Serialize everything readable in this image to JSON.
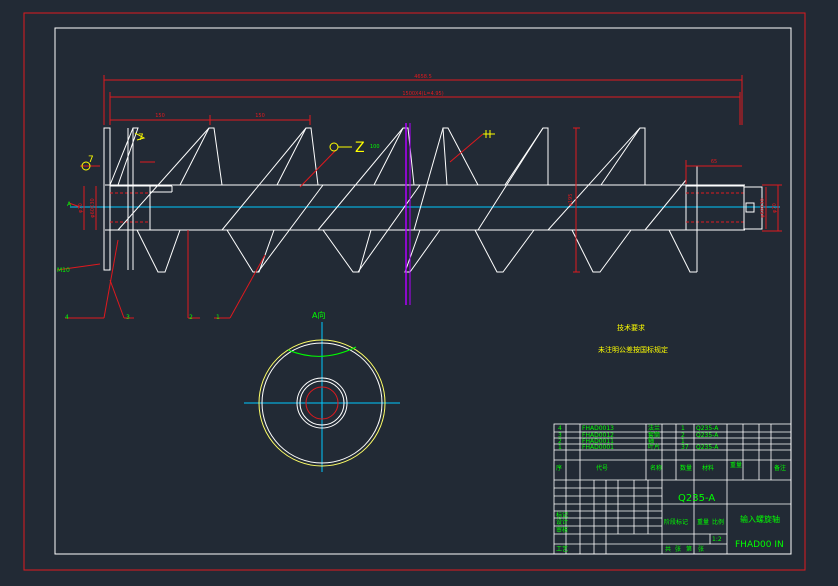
{
  "colors": {
    "background": "#222a35",
    "frame_outer": "#e0191e",
    "frame_inner": "#ffffff",
    "dimension": "#e0191e",
    "annotation": "#00ff00",
    "center_line": "#00c8ff",
    "cut_line": "#b000ff",
    "section_curve": "#ffff66",
    "text_yellow": "#ffff00"
  },
  "dimensions": {
    "overall_length": "4658.5",
    "spiral_length": "1500X4(L=4.95)",
    "pitch_a": "150",
    "pitch_b": "150",
    "end_length": "65",
    "outer_diameter": "φ195",
    "shaft_left": "φ70",
    "shaft_left_bore": "φ60X30",
    "shaft_center": "φ68",
    "shaft_right": "φ70",
    "shaft_right_bore": "φ60X30"
  },
  "callouts": {
    "section_mark": "A",
    "section_view_label": "A向",
    "part_1": "1",
    "part_2": "2",
    "part_3": "3",
    "part_4": "4",
    "weld_left_top": "7",
    "weld_left_mid": "7",
    "weld_left_bottom": "M10",
    "weld_symbol": "Z",
    "weld_note": "100",
    "spacer_note": "5"
  },
  "notes": {
    "title": "技术要求",
    "line1": "未注明公差按国标规定"
  },
  "title_block": {
    "material": "Q235-A",
    "drawing_name": "输入螺旋轴",
    "drawing_code": "FHAD00 IN",
    "scale": "1:2",
    "bom_rows": [
      {
        "no": "4",
        "code": "FHAD0013",
        "name": "法兰",
        "qty": "1",
        "mat": "Q235-A"
      },
      {
        "no": "3",
        "code": "FHAD0012",
        "name": "套筒",
        "qty": "2",
        "mat": "Q235-A"
      },
      {
        "no": "2",
        "code": "FHAD0011",
        "name": "轴",
        "qty": "1",
        "mat": ""
      },
      {
        "no": "1",
        "code": "FHAD0001",
        "name": "叶片",
        "qty": "37",
        "mat": "Q235-A"
      }
    ],
    "header": {
      "no": "序",
      "code": "代号",
      "name": "名称",
      "qty": "数量",
      "mat": "材料",
      "remark": "备注",
      "weight": "重量"
    },
    "left_labels": [
      "标记",
      "设计",
      "审核",
      "工艺"
    ],
    "stage_label": "阶段标记",
    "weight_label": "重量",
    "ratio_label": "比例",
    "sheet_labels": [
      "共",
      "张",
      "第",
      "张"
    ]
  }
}
